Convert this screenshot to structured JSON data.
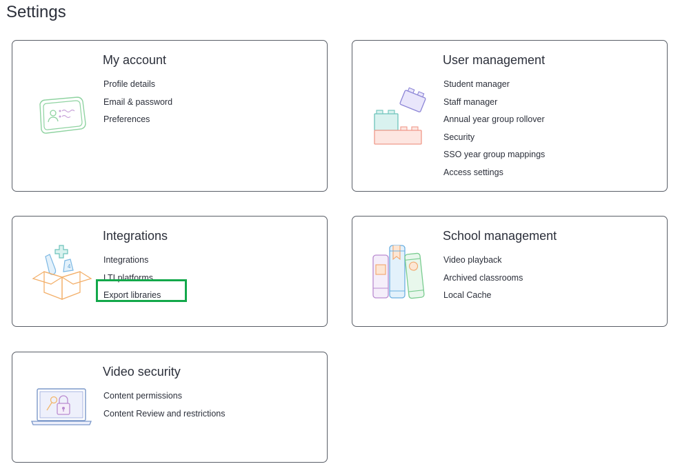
{
  "page": {
    "title": "Settings"
  },
  "cards": {
    "my_account": {
      "title": "My account",
      "icon": "id-card-icon",
      "links": [
        "Profile details",
        "Email & password",
        "Preferences"
      ]
    },
    "user_management": {
      "title": "User management",
      "icon": "building-blocks-icon",
      "links": [
        "Student manager",
        "Staff manager",
        "Annual year group rollover",
        "Security",
        "SSO year group mappings",
        "Access settings"
      ]
    },
    "integrations": {
      "title": "Integrations",
      "icon": "open-box-icon",
      "links": [
        "Integrations",
        "LTI platforms",
        "Export libraries"
      ]
    },
    "school_management": {
      "title": "School management",
      "icon": "books-icon",
      "links": [
        "Video playback",
        "Archived classrooms",
        "Local Cache"
      ]
    },
    "video_security": {
      "title": "Video security",
      "icon": "laptop-lock-icon",
      "links": [
        "Content permissions",
        "Content Review and restrictions"
      ]
    }
  },
  "colors": {
    "highlight": "#12a84a",
    "card_border": "#585d66",
    "text": "#2b2f3a"
  }
}
